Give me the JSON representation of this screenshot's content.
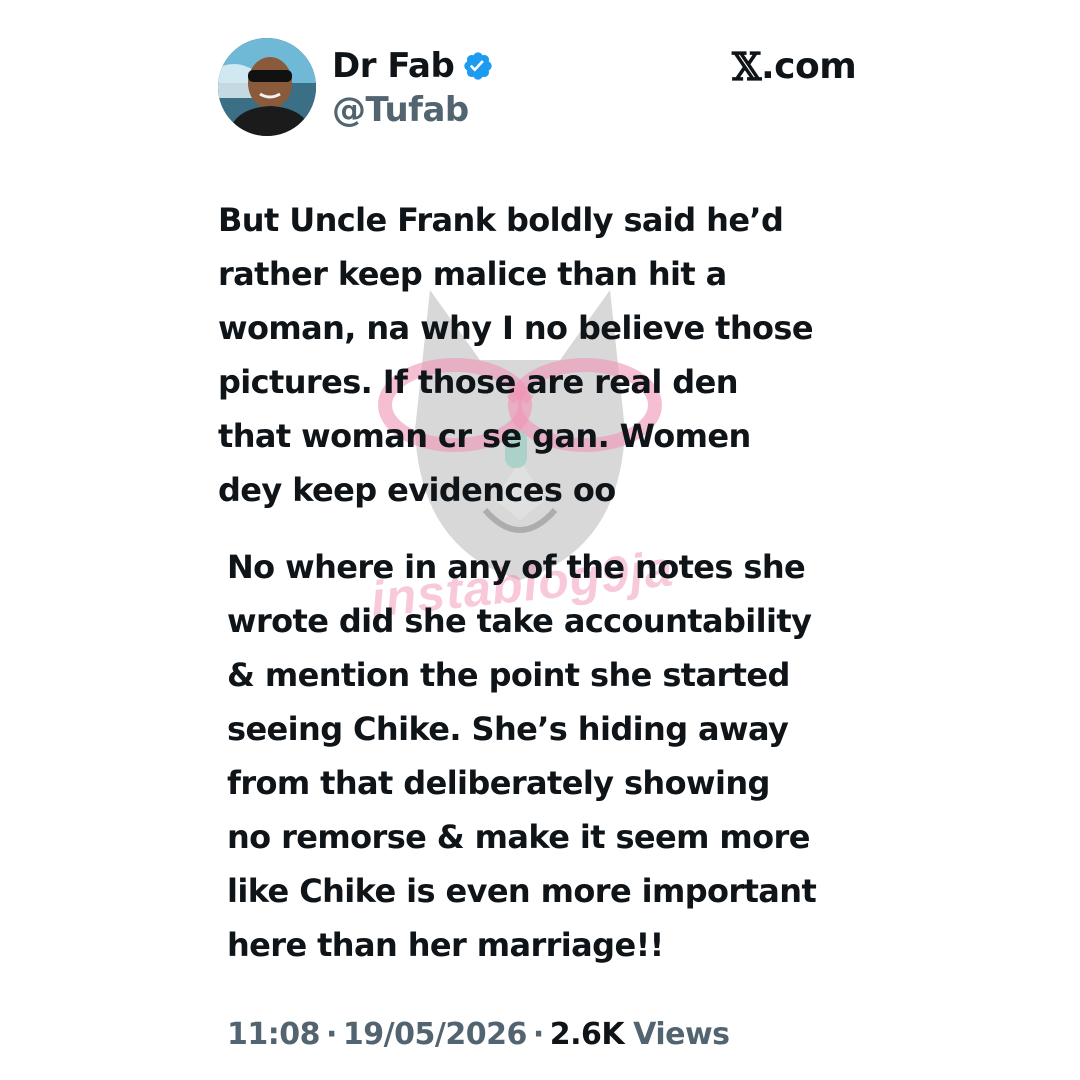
{
  "author": {
    "display_name": "Dr Fab",
    "handle": "@Tufab",
    "verified": true,
    "avatar_icon": "profile-photo"
  },
  "site": {
    "logo": "𝕏",
    "domain": ".com"
  },
  "tweet": {
    "paragraph_1": "But Uncle Frank boldly said he’d\nrather keep malice than hit a\nwoman, na why I no believe those\npictures. If those are real den\nthat woman cr  se gan. Women\ndey keep evidences oo",
    "paragraph_2": "No where in any of the notes she\nwrote did she take accountability\n& mention the point she started\nseeing Chike. She’s hiding away\nfrom that deliberately showing\nno remorse & make it seem more\nlike Chike is even more important\nhere than her marriage!!"
  },
  "meta": {
    "time": "11:08",
    "separator": "·",
    "date": "19/05/2026",
    "views_count": "2.6K",
    "views_label": "Views"
  },
  "watermark": {
    "text": "instablog9ja",
    "icon": "cat-with-glasses-icon"
  },
  "colors": {
    "text": "#0f1419",
    "secondary": "#536471",
    "verified_badge": "#1d9bf0",
    "watermark_pink": "#ec709e"
  }
}
